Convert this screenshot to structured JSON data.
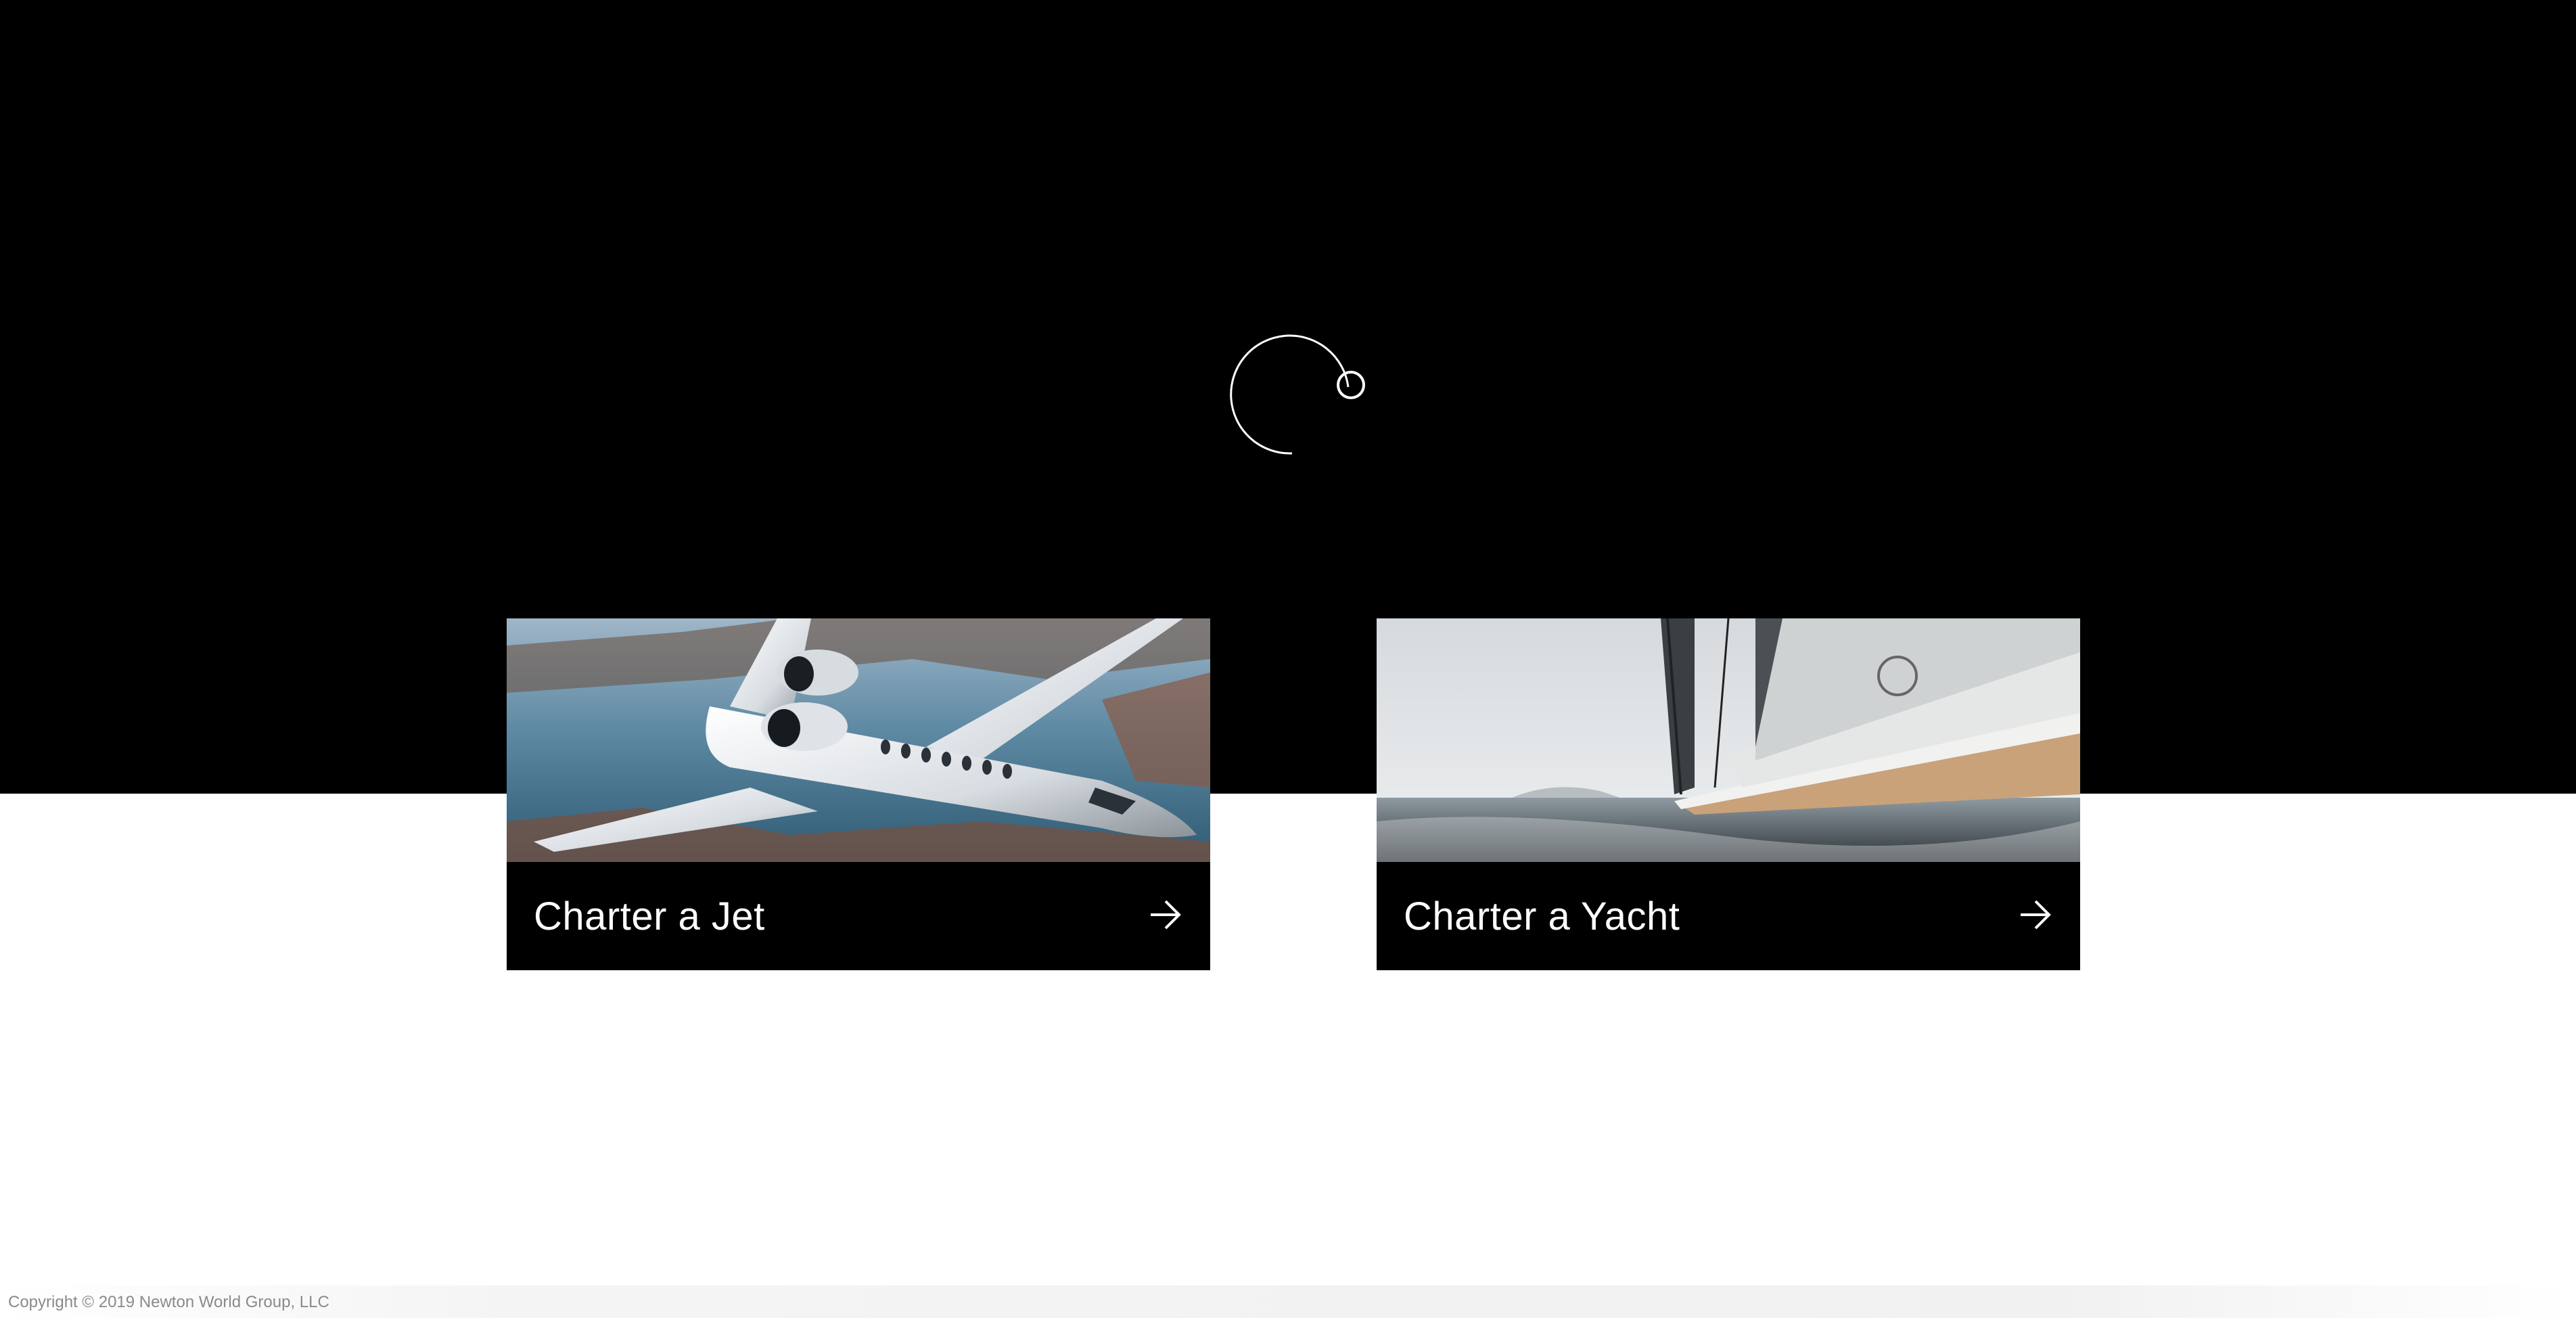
{
  "brand": {
    "logo_icon": "orbit-logo-icon"
  },
  "cards": [
    {
      "label": "Charter a Jet",
      "image_subject": "jet-photo",
      "arrow_icon": "arrow-right-icon"
    },
    {
      "label": "Charter a Yacht",
      "image_subject": "yacht-photo",
      "arrow_icon": "arrow-right-icon"
    }
  ],
  "footer": {
    "copyright": "Copyright © 2019 Newton World Group, LLC"
  },
  "colors": {
    "band": "#000000",
    "background": "#ffffff",
    "card_footer": "#000000",
    "card_text": "#ffffff",
    "copyright_text": "#8a8a8a"
  }
}
